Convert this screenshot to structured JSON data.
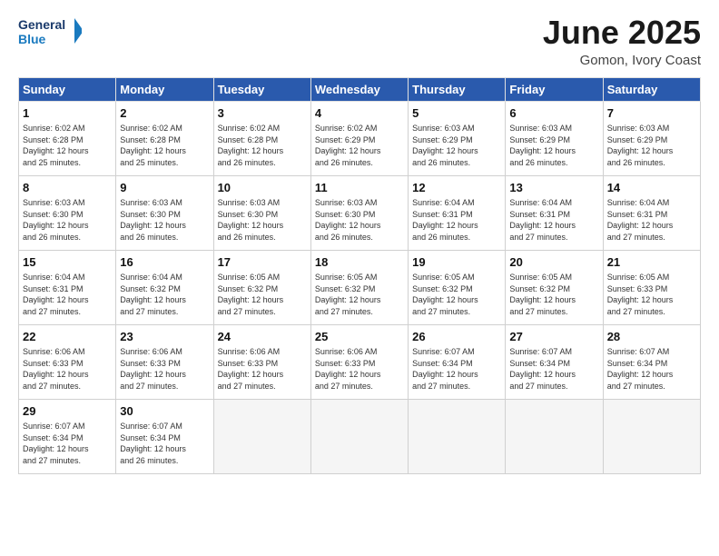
{
  "header": {
    "logo_line1": "General",
    "logo_line2": "Blue",
    "month_title": "June 2025",
    "location": "Gomon, Ivory Coast"
  },
  "weekdays": [
    "Sunday",
    "Monday",
    "Tuesday",
    "Wednesday",
    "Thursday",
    "Friday",
    "Saturday"
  ],
  "weeks": [
    [
      {
        "day": "1",
        "lines": [
          "Sunrise: 6:02 AM",
          "Sunset: 6:28 PM",
          "Daylight: 12 hours",
          "and 25 minutes."
        ]
      },
      {
        "day": "2",
        "lines": [
          "Sunrise: 6:02 AM",
          "Sunset: 6:28 PM",
          "Daylight: 12 hours",
          "and 25 minutes."
        ]
      },
      {
        "day": "3",
        "lines": [
          "Sunrise: 6:02 AM",
          "Sunset: 6:28 PM",
          "Daylight: 12 hours",
          "and 26 minutes."
        ]
      },
      {
        "day": "4",
        "lines": [
          "Sunrise: 6:02 AM",
          "Sunset: 6:29 PM",
          "Daylight: 12 hours",
          "and 26 minutes."
        ]
      },
      {
        "day": "5",
        "lines": [
          "Sunrise: 6:03 AM",
          "Sunset: 6:29 PM",
          "Daylight: 12 hours",
          "and 26 minutes."
        ]
      },
      {
        "day": "6",
        "lines": [
          "Sunrise: 6:03 AM",
          "Sunset: 6:29 PM",
          "Daylight: 12 hours",
          "and 26 minutes."
        ]
      },
      {
        "day": "7",
        "lines": [
          "Sunrise: 6:03 AM",
          "Sunset: 6:29 PM",
          "Daylight: 12 hours",
          "and 26 minutes."
        ]
      }
    ],
    [
      {
        "day": "8",
        "lines": [
          "Sunrise: 6:03 AM",
          "Sunset: 6:30 PM",
          "Daylight: 12 hours",
          "and 26 minutes."
        ]
      },
      {
        "day": "9",
        "lines": [
          "Sunrise: 6:03 AM",
          "Sunset: 6:30 PM",
          "Daylight: 12 hours",
          "and 26 minutes."
        ]
      },
      {
        "day": "10",
        "lines": [
          "Sunrise: 6:03 AM",
          "Sunset: 6:30 PM",
          "Daylight: 12 hours",
          "and 26 minutes."
        ]
      },
      {
        "day": "11",
        "lines": [
          "Sunrise: 6:03 AM",
          "Sunset: 6:30 PM",
          "Daylight: 12 hours",
          "and 26 minutes."
        ]
      },
      {
        "day": "12",
        "lines": [
          "Sunrise: 6:04 AM",
          "Sunset: 6:31 PM",
          "Daylight: 12 hours",
          "and 26 minutes."
        ]
      },
      {
        "day": "13",
        "lines": [
          "Sunrise: 6:04 AM",
          "Sunset: 6:31 PM",
          "Daylight: 12 hours",
          "and 27 minutes."
        ]
      },
      {
        "day": "14",
        "lines": [
          "Sunrise: 6:04 AM",
          "Sunset: 6:31 PM",
          "Daylight: 12 hours",
          "and 27 minutes."
        ]
      }
    ],
    [
      {
        "day": "15",
        "lines": [
          "Sunrise: 6:04 AM",
          "Sunset: 6:31 PM",
          "Daylight: 12 hours",
          "and 27 minutes."
        ]
      },
      {
        "day": "16",
        "lines": [
          "Sunrise: 6:04 AM",
          "Sunset: 6:32 PM",
          "Daylight: 12 hours",
          "and 27 minutes."
        ]
      },
      {
        "day": "17",
        "lines": [
          "Sunrise: 6:05 AM",
          "Sunset: 6:32 PM",
          "Daylight: 12 hours",
          "and 27 minutes."
        ]
      },
      {
        "day": "18",
        "lines": [
          "Sunrise: 6:05 AM",
          "Sunset: 6:32 PM",
          "Daylight: 12 hours",
          "and 27 minutes."
        ]
      },
      {
        "day": "19",
        "lines": [
          "Sunrise: 6:05 AM",
          "Sunset: 6:32 PM",
          "Daylight: 12 hours",
          "and 27 minutes."
        ]
      },
      {
        "day": "20",
        "lines": [
          "Sunrise: 6:05 AM",
          "Sunset: 6:32 PM",
          "Daylight: 12 hours",
          "and 27 minutes."
        ]
      },
      {
        "day": "21",
        "lines": [
          "Sunrise: 6:05 AM",
          "Sunset: 6:33 PM",
          "Daylight: 12 hours",
          "and 27 minutes."
        ]
      }
    ],
    [
      {
        "day": "22",
        "lines": [
          "Sunrise: 6:06 AM",
          "Sunset: 6:33 PM",
          "Daylight: 12 hours",
          "and 27 minutes."
        ]
      },
      {
        "day": "23",
        "lines": [
          "Sunrise: 6:06 AM",
          "Sunset: 6:33 PM",
          "Daylight: 12 hours",
          "and 27 minutes."
        ]
      },
      {
        "day": "24",
        "lines": [
          "Sunrise: 6:06 AM",
          "Sunset: 6:33 PM",
          "Daylight: 12 hours",
          "and 27 minutes."
        ]
      },
      {
        "day": "25",
        "lines": [
          "Sunrise: 6:06 AM",
          "Sunset: 6:33 PM",
          "Daylight: 12 hours",
          "and 27 minutes."
        ]
      },
      {
        "day": "26",
        "lines": [
          "Sunrise: 6:07 AM",
          "Sunset: 6:34 PM",
          "Daylight: 12 hours",
          "and 27 minutes."
        ]
      },
      {
        "day": "27",
        "lines": [
          "Sunrise: 6:07 AM",
          "Sunset: 6:34 PM",
          "Daylight: 12 hours",
          "and 27 minutes."
        ]
      },
      {
        "day": "28",
        "lines": [
          "Sunrise: 6:07 AM",
          "Sunset: 6:34 PM",
          "Daylight: 12 hours",
          "and 27 minutes."
        ]
      }
    ],
    [
      {
        "day": "29",
        "lines": [
          "Sunrise: 6:07 AM",
          "Sunset: 6:34 PM",
          "Daylight: 12 hours",
          "and 27 minutes."
        ]
      },
      {
        "day": "30",
        "lines": [
          "Sunrise: 6:07 AM",
          "Sunset: 6:34 PM",
          "Daylight: 12 hours",
          "and 26 minutes."
        ]
      },
      {
        "day": "",
        "lines": []
      },
      {
        "day": "",
        "lines": []
      },
      {
        "day": "",
        "lines": []
      },
      {
        "day": "",
        "lines": []
      },
      {
        "day": "",
        "lines": []
      }
    ]
  ]
}
